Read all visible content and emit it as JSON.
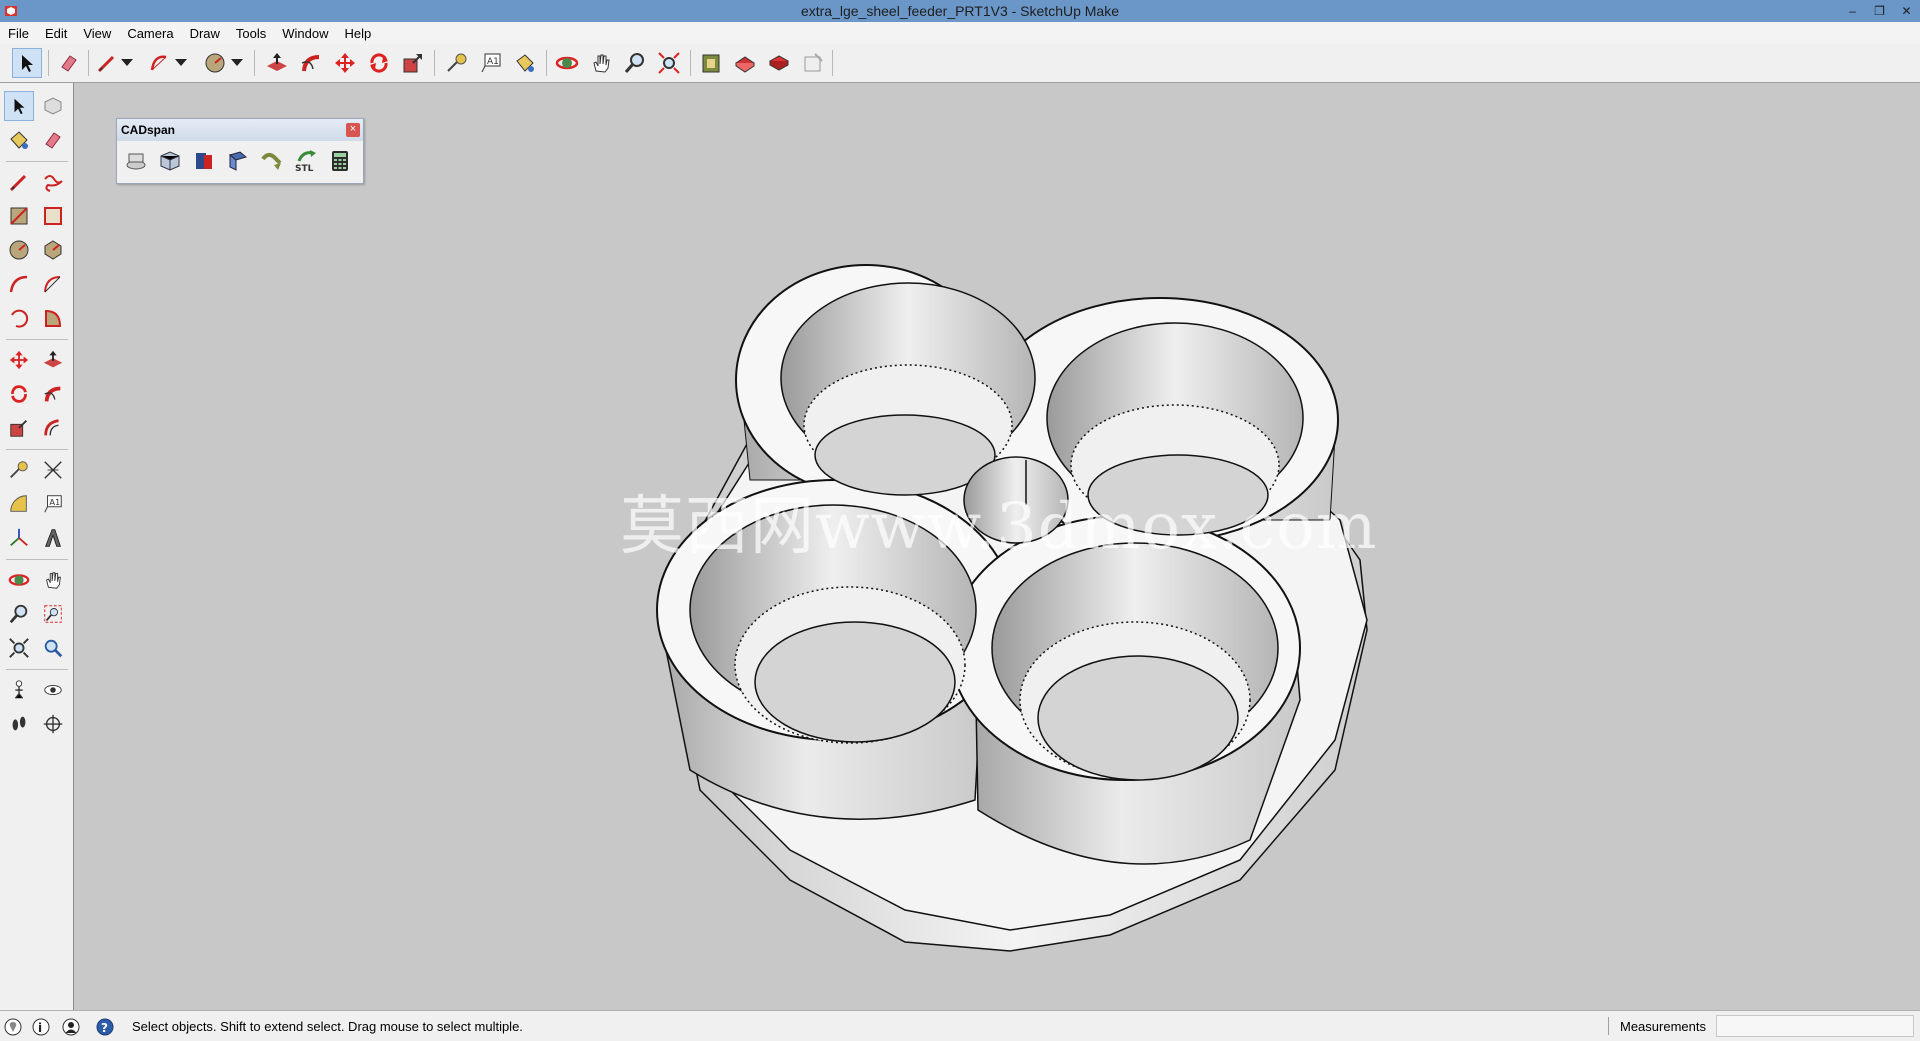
{
  "window": {
    "title": "extra_lge_sheel_feeder_PRT1V3 - SketchUp Make",
    "minimize": "–",
    "restore": "❐",
    "close": "✕"
  },
  "menu": [
    "File",
    "Edit",
    "View",
    "Camera",
    "Draw",
    "Tools",
    "Window",
    "Help"
  ],
  "cadspan": {
    "title": "CADspan",
    "close": "×",
    "stl_label": "STL"
  },
  "watermark": "莫西网www.3dmox.com",
  "status": {
    "hint": "Select objects. Shift to extend select. Drag mouse to select multiple.",
    "measurements_label": "Measurements",
    "measurements_value": ""
  },
  "colors": {
    "titlebar": "#6a97c8",
    "viewport": "#c8c8c8",
    "model_face": "#f2f2f2",
    "accent_red": "#d9342b"
  }
}
